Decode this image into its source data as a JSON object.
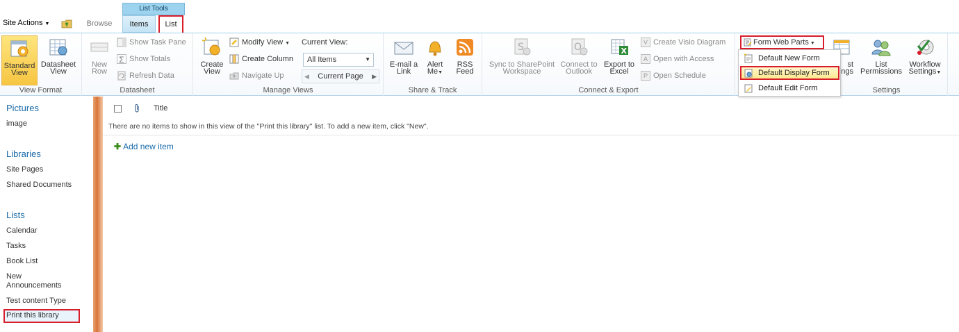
{
  "topbar": {
    "site_actions": "Site Actions",
    "tab_browse": "Browse",
    "list_tools": "List Tools",
    "tab_items": "Items",
    "tab_list": "List"
  },
  "ribbon": {
    "view_format": {
      "label": "View Format",
      "standard_view": "Standard View",
      "datasheet_view": "Datasheet View"
    },
    "datasheet": {
      "label": "Datasheet",
      "new_row": "New Row",
      "show_task_pane": "Show Task Pane",
      "show_totals": "Show Totals",
      "refresh_data": "Refresh Data"
    },
    "manage_views": {
      "label": "Manage Views",
      "create_view": "Create View",
      "modify_view": "Modify View",
      "create_column": "Create Column",
      "navigate_up": "Navigate Up",
      "current_view_label": "Current View:",
      "current_view_value": "All Items",
      "current_page": "Current Page"
    },
    "share_track": {
      "label": "Share & Track",
      "email_link": "E-mail a Link",
      "alert_me": "Alert Me",
      "rss_feed": "RSS Feed"
    },
    "connect_export": {
      "label": "Connect & Export",
      "sync_sharepoint": "Sync to SharePoint Workspace",
      "connect_outlook": "Connect to Outlook",
      "export_excel": "Export to Excel",
      "create_visio": "Create Visio Diagram",
      "open_access": "Open with Access",
      "open_schedule": "Open Schedule"
    },
    "settings": {
      "label": "Settings",
      "form_web_parts": "Form Web Parts",
      "list_settings_partial": "st\nings",
      "list_permissions": "List Permissions",
      "workflow_settings": "Workflow Settings"
    },
    "form_menu": [
      "Default New Form",
      "Default Display Form",
      "Default Edit Form"
    ]
  },
  "leftnav": {
    "pictures_head": "Pictures",
    "pictures": [
      "image"
    ],
    "libraries_head": "Libraries",
    "libraries": [
      "Site Pages",
      "Shared Documents"
    ],
    "lists_head": "Lists",
    "lists": [
      "Calendar",
      "Tasks",
      "Book List",
      "New Announcements",
      "Test content Type",
      "Print this library"
    ]
  },
  "main": {
    "col_title": "Title",
    "empty_message": "There are no items to show in this view of the \"Print this library\" list. To add a new item, click \"New\".",
    "add_new_item": "Add new item"
  },
  "colors": {
    "accent_blue": "#1b6cab",
    "highlight_red": "#d81e2a",
    "selected_yellow": "#f7c542"
  }
}
